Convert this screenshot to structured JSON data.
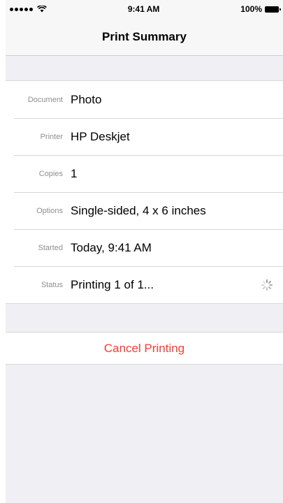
{
  "status_bar": {
    "time": "9:41 AM",
    "battery": "100%",
    "signal_icon": "signal-dots-icon",
    "wifi_icon": "wifi-icon",
    "battery_icon": "battery-icon"
  },
  "navbar": {
    "title": "Print Summary"
  },
  "details": [
    {
      "label": "Document",
      "value": "Photo"
    },
    {
      "label": "Printer",
      "value": "HP Deskjet"
    },
    {
      "label": "Copies",
      "value": "1"
    },
    {
      "label": "Options",
      "value": "Single-sided, 4 x 6 inches"
    },
    {
      "label": "Started",
      "value": "Today, 9:41 AM"
    },
    {
      "label": "Status",
      "value": "Printing 1 of 1..."
    }
  ],
  "status_indicator_icon": "activity-spinner-icon",
  "actions": {
    "cancel_label": "Cancel Printing"
  },
  "colors": {
    "accent_destructive": "#ff3b30",
    "background": "#efeff4"
  }
}
